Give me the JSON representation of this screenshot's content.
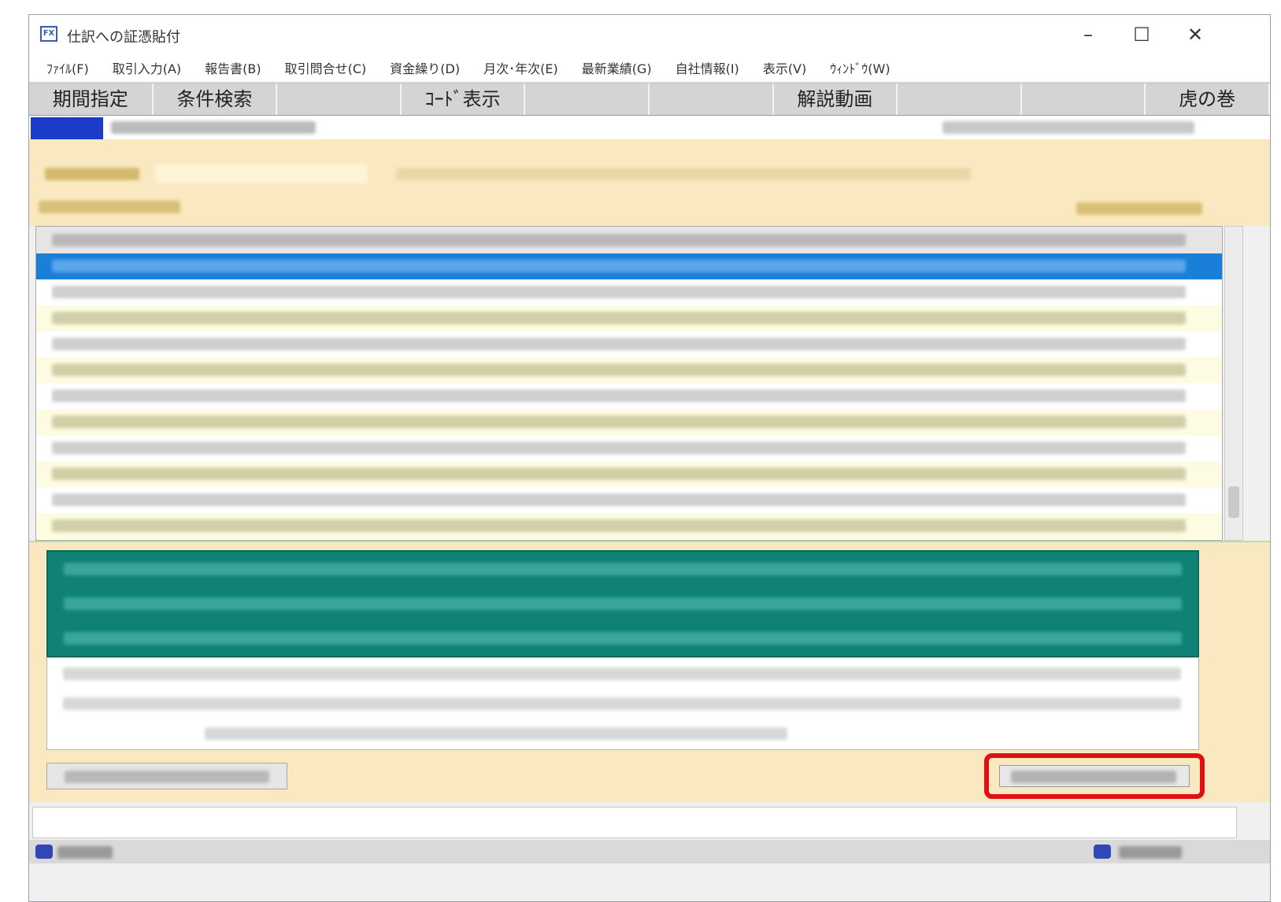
{
  "window": {
    "title": "仕訳への証憑貼付",
    "icon": "fx-app-icon",
    "controls": [
      "minimize-icon",
      "maximize-icon",
      "close-icon"
    ]
  },
  "menu": [
    "ﾌｧｲﾙ(F)",
    "取引入力(A)",
    "報告書(B)",
    "取引問合せ(C)",
    "資金繰り(D)",
    "月次･年次(E)",
    "最新業績(G)",
    "自社情報(I)",
    "表示(V)",
    "ｳｨﾝﾄﾞｳ(W)"
  ],
  "function_keys": [
    "期間指定",
    "条件検索",
    "",
    "ｺｰﾄﾞ表示",
    "",
    "",
    "解説動画",
    "",
    "",
    "虎の巻"
  ],
  "colors": {
    "selection": "#1a7fd6",
    "panel": "#fae9c0",
    "header": "#0f8275",
    "highlight": "#e01010"
  }
}
